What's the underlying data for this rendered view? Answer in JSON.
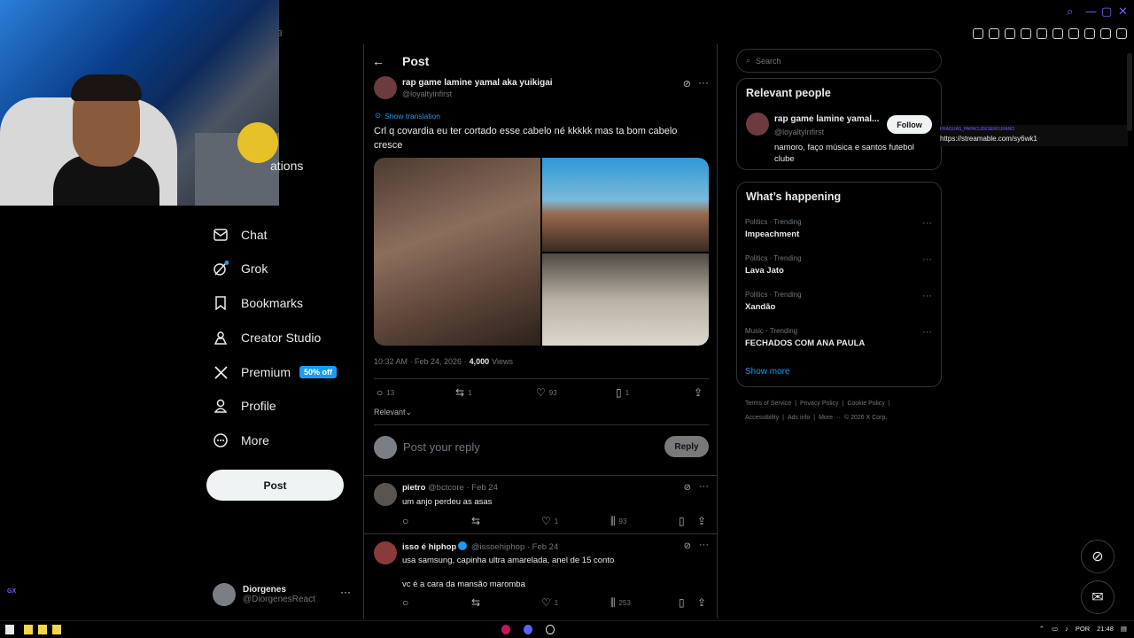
{
  "browser": {
    "tab_number": "3"
  },
  "sidebar": {
    "items": [
      {
        "label": "ations"
      },
      {
        "label": "Chat"
      },
      {
        "label": "Grok"
      },
      {
        "label": "Bookmarks"
      },
      {
        "label": "Creator Studio"
      },
      {
        "label": "Premium",
        "badge": "50% off"
      },
      {
        "label": "Profile"
      },
      {
        "label": "More"
      }
    ],
    "post_button": "Post",
    "account": {
      "name": "Diorgenes",
      "handle": "@DiorgenesReact"
    },
    "gx_label": "GX"
  },
  "post": {
    "header_title": "Post",
    "author_name": "rap game lamine yamal aka yuikigai",
    "author_handle": "@loyaltyinfirst",
    "show_translation": "Show translation",
    "text": "Crl q covardia eu ter cortado esse cabelo né kkkkk mas ta bom cabelo cresce",
    "time": "10:32 AM · Feb 24, 2026 ·",
    "views_count": "4,000",
    "views_label": "Views",
    "replies": "13",
    "reposts": "1",
    "likes": "93",
    "bookmarks": "1",
    "sort_label": "Relevant",
    "reply_placeholder": "Post your reply",
    "reply_button": "Reply"
  },
  "comments": [
    {
      "name": "pietro",
      "handle": "@bctcore · Feb 24",
      "text": "um anjo perdeu as asas",
      "likes": "1",
      "views": "93"
    },
    {
      "name": "isso é hiphop",
      "handle": "@issoehiphop · Feb 24",
      "text": "usa samsung, capinha ultra amarelada, anel de 15 conto",
      "text2": "vc é a cara da mansão maromba",
      "likes": "1",
      "views": "253"
    }
  ],
  "right": {
    "search_placeholder": "Search",
    "relevant_title": "Relevant people",
    "person_name": "rap game lamine yamal...",
    "person_handle": "@loyaltyinfirst",
    "follow_label": "Follow",
    "person_bio": "namoro, faço música e santos futebol clube",
    "happening_title": "What’s happening",
    "trends": [
      {
        "cat": "Politics · Trending",
        "name": "Impeachment"
      },
      {
        "cat": "Politics · Trending",
        "name": "Lava Jato"
      },
      {
        "cat": "Politics · Trending",
        "name": "Xandão"
      },
      {
        "cat": "Music · Trending",
        "name": "FECHADOS COM ANA PAULA"
      }
    ],
    "show_more": "Show more",
    "footer": [
      "Terms of Service",
      "|",
      "Privacy Policy",
      "|",
      "Cookie Policy",
      "|",
      "Accessibility",
      "|",
      "Ads info",
      "|",
      "More ···",
      "© 2026 X Corp."
    ]
  },
  "overlay": {
    "small_label": "FRAGUAS_PAPACUDESEROJFANO",
    "url": "https://streamable.com/sy6wk1"
  },
  "taskbar": {
    "language": "POR",
    "clock": "21:48"
  },
  "colors": {
    "accent": "#1d9bf0",
    "background": "#000000",
    "border": "#2f3336"
  }
}
